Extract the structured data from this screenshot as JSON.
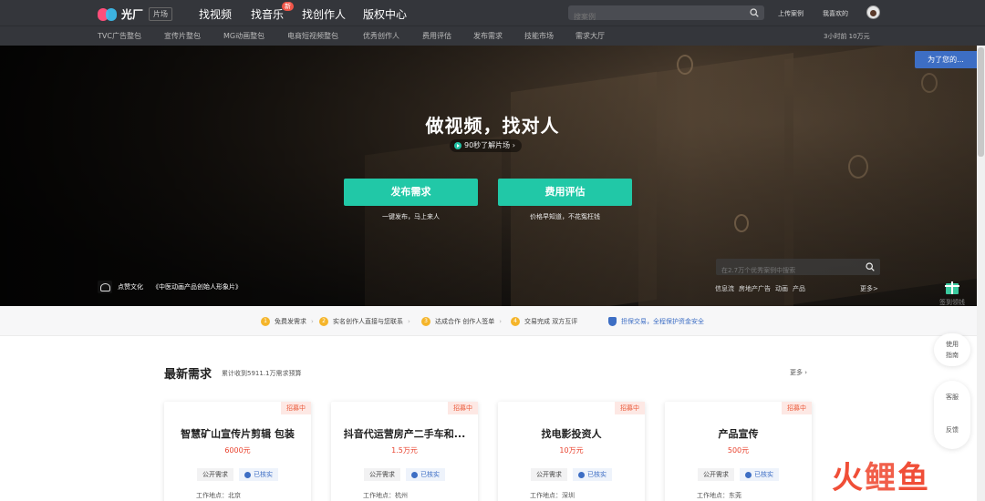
{
  "brand": {
    "name": "光厂",
    "tag": "片场",
    "colors": {
      "pink": "#ff4e7a",
      "blue": "#3dc1f3"
    }
  },
  "nav": {
    "items": [
      "找视频",
      "找音乐",
      "找创作人",
      "版权中心"
    ],
    "active": "找创作人",
    "new_badge": "新"
  },
  "search": {
    "placeholder": "搜案例",
    "icon": "search-icon"
  },
  "top_links": {
    "upload": "上传案例",
    "favorites": "我喜欢的"
  },
  "subnav": {
    "items": [
      "TVC广告整包",
      "宣传片整包",
      "MG动画整包",
      "电商短视频整包",
      "优秀创作人",
      "费用评估",
      "发布需求",
      "技能市场",
      "需求大厅"
    ],
    "ticker": "3小时前 10万元"
  },
  "side_banner": "为了您的...",
  "hero": {
    "title": "做视频，找对人",
    "pill": "90秒了解片场 ›",
    "cta_left": {
      "label": "发布需求",
      "sub": "一键发布，马上来人"
    },
    "cta_right": {
      "label": "费用评估",
      "sub": "价格早知道，不花冤枉钱"
    },
    "accent": "#21c8a7",
    "credit_studio": "点赞文化",
    "credit_title": "《中医动画产品创始人形象片》",
    "search_placeholder": "在2.7万个优秀案例中搜索",
    "tags": [
      "信息流",
      "房地产广告",
      "动画",
      "产品"
    ],
    "more": "更多>"
  },
  "gift": {
    "label": "签到领钱"
  },
  "steps": [
    {
      "n": "1",
      "text": "免费发需求"
    },
    {
      "n": "2",
      "text": "实名创作人直接与您联系"
    },
    {
      "n": "3",
      "text": "达成合作 创作人签单"
    },
    {
      "n": "4",
      "text": "交易完成 双方互评"
    }
  ],
  "guarantee": "担保交易，全程保护资金安全",
  "section": {
    "title": "最新需求",
    "subtitle": "累计收到5911.1万需求预算",
    "more": "更多 ›"
  },
  "cards": [
    {
      "badge": "招募中",
      "title": "智慧矿山宣传片剪辑 包装",
      "price": "6000元",
      "tag1": "公开需求",
      "tag2": "已核实",
      "loc": "工作地点：北京"
    },
    {
      "badge": "招募中",
      "title": "抖音代运营房产二手车和...",
      "price": "1.5万元",
      "tag1": "公开需求",
      "tag2": "已核实",
      "loc": "工作地点：杭州"
    },
    {
      "badge": "招募中",
      "title": "找电影投资人",
      "price": "10万元",
      "tag1": "公开需求",
      "tag2": "已核实",
      "loc": "工作地点：深圳"
    },
    {
      "badge": "招募中",
      "title": "产品宣传",
      "price": "500元",
      "tag1": "公开需求",
      "tag2": "已核实",
      "loc": "工作地点：东莞"
    }
  ],
  "float_menu": {
    "guide_1": "使用",
    "guide_2": "指南",
    "service": "客服",
    "feedback": "反馈"
  },
  "watermark": {
    "c1": "火",
    "c2": "鲤",
    "c3": "鱼"
  }
}
